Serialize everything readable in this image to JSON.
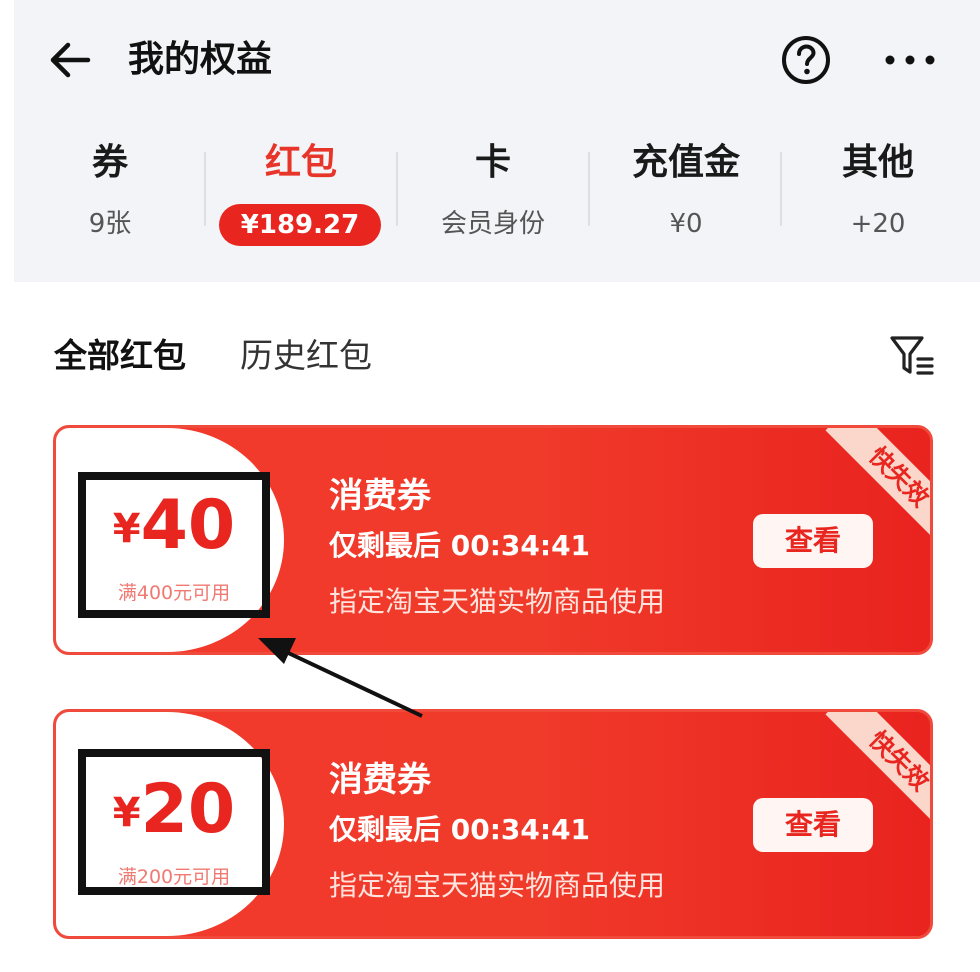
{
  "header": {
    "title": "我的权益",
    "back_icon": "arrow-left-icon",
    "help_icon": "question-circle-icon",
    "more_icon": "ellipsis-icon"
  },
  "tabs": [
    {
      "label": "券",
      "sub": "9张"
    },
    {
      "label": "红包",
      "sub": "¥189.27",
      "active": true
    },
    {
      "label": "卡",
      "sub": "会员身份"
    },
    {
      "label": "充值金",
      "sub": "¥0"
    },
    {
      "label": "其他",
      "sub": "+20"
    }
  ],
  "sub_tabs": [
    {
      "label": "全部红包",
      "active": true
    },
    {
      "label": "历史红包"
    }
  ],
  "filter_icon": "filter-icon",
  "coupons": [
    {
      "currency": "¥",
      "amount": "40",
      "threshold": "满400元可用",
      "title": "消费券",
      "timer": "仅剩最后 00:34:41",
      "desc": "指定淘宝天猫实物商品使用",
      "button": "查看",
      "ribbon": "快失效"
    },
    {
      "currency": "¥",
      "amount": "20",
      "threshold": "满200元可用",
      "title": "消费券",
      "timer": "仅剩最后 00:34:41",
      "desc": "指定淘宝天猫实物商品使用",
      "button": "查看",
      "ribbon": "快失效"
    }
  ],
  "colors": {
    "accent": "#e8251f",
    "band_bg": "#f3f4f8",
    "ribbon_bg": "#fbd6ca"
  }
}
